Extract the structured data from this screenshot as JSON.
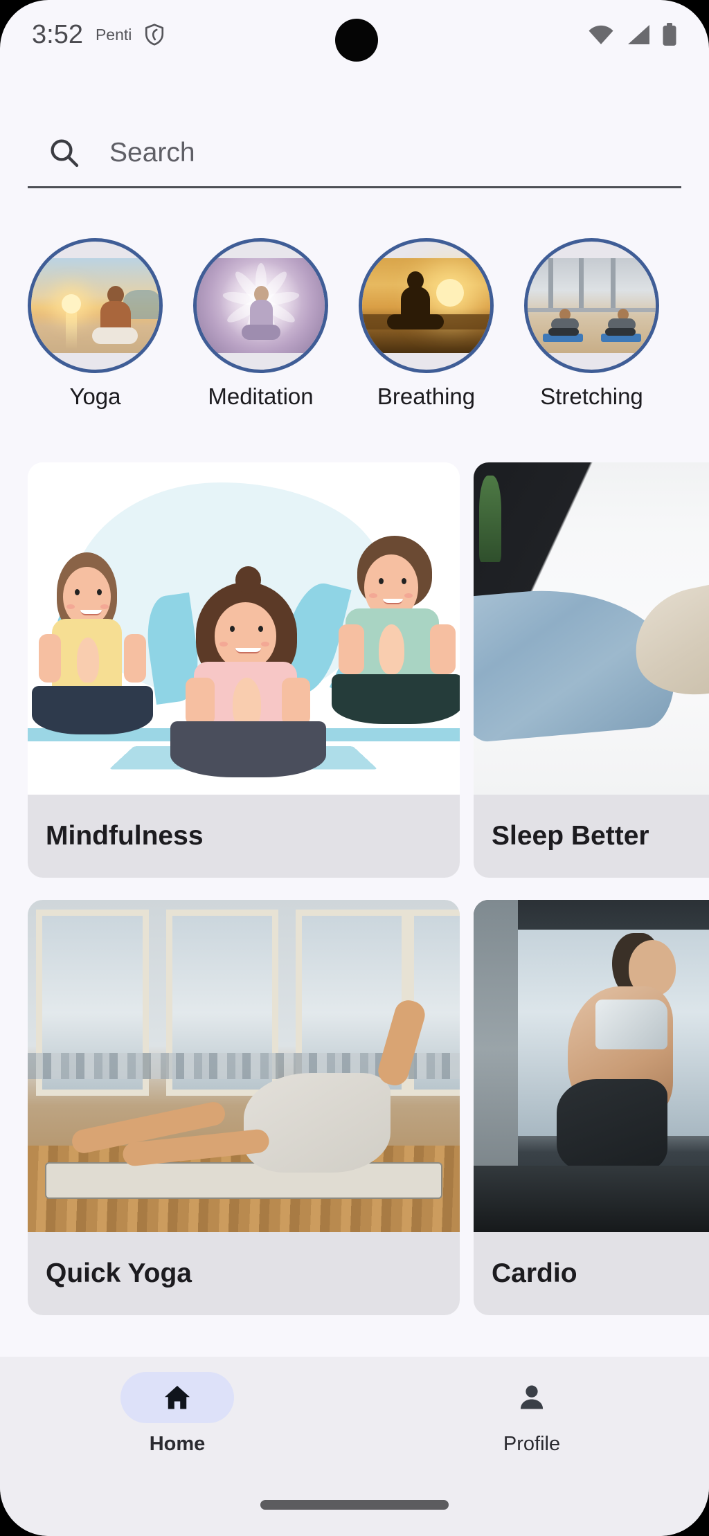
{
  "status_bar": {
    "time": "3:52",
    "carrier": "Penti",
    "icons": [
      "shield-icon",
      "wifi-icon",
      "cellular-signal-icon",
      "battery-icon"
    ]
  },
  "search": {
    "placeholder": "Search",
    "value": "",
    "icon": "search-icon"
  },
  "categories": [
    {
      "label": "Yoga",
      "image_alt": "man meditating on beach at sunrise"
    },
    {
      "label": "Meditation",
      "image_alt": "woman in lotus pose with purple lotus aura"
    },
    {
      "label": "Breathing",
      "image_alt": "silhouette meditating at golden sunset"
    },
    {
      "label": "Stretching",
      "image_alt": "two people stretching on blue mats in gym"
    }
  ],
  "cards": [
    {
      "title": "Mindfulness",
      "image_alt": "illustration of three people meditating with blue leaves"
    },
    {
      "title": "Sleep Better",
      "image_alt": "person sleeping under blue blanket on white bed"
    },
    {
      "title": "Quick Yoga",
      "image_alt": "woman doing yoga on mat by large windows"
    },
    {
      "title": "Cardio",
      "image_alt": "woman running on treadmill in gym"
    }
  ],
  "bottom_nav": {
    "items": [
      {
        "label": "Home",
        "icon": "home-icon",
        "active": true
      },
      {
        "label": "Profile",
        "icon": "person-icon",
        "active": false
      }
    ]
  },
  "colors": {
    "page_background": "#F8F7FC",
    "category_ring": "#3F5D96",
    "card_label_bar": "#E2E1E6",
    "nav_background": "#EEEDF2",
    "nav_active_pill": "#DDE1F9",
    "text_primary": "#1C1B1F",
    "gesture_bar": "#5C5C5F"
  }
}
